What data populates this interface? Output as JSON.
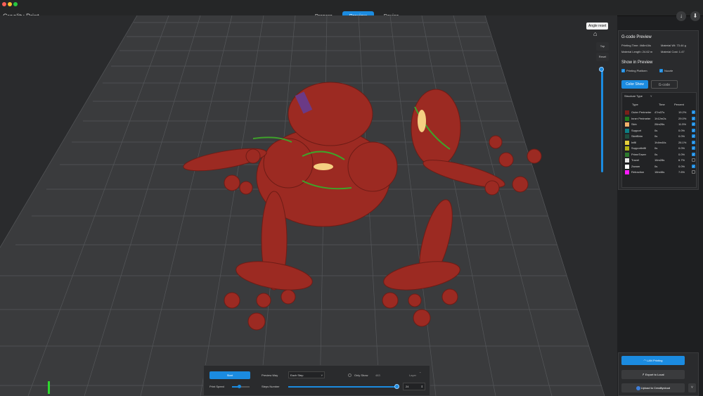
{
  "window": {
    "traffic_lights": [
      "#ff5f57",
      "#febc2e",
      "#28c840"
    ]
  },
  "app": {
    "title": "Creality Print"
  },
  "tabs": [
    {
      "label": "Prepare",
      "active": false
    },
    {
      "label": "Preview",
      "active": true
    },
    {
      "label": "Device",
      "active": false
    }
  ],
  "toolbar": {
    "download_icon": "arrow-down-icon",
    "save_icon": "upload-icon"
  },
  "view_tools": {
    "tooltip": "Angle reset",
    "top_label": "Top",
    "reset_label": "Reset"
  },
  "gcode_preview": {
    "title": "G-code Preview",
    "printing_time": "Printing Time: 4h8m16s",
    "material_wt": "Material Wt: 73.44 g",
    "material_length": "Material Length: 24.62 m",
    "material_cost": "Material Cost: 1.47",
    "show_in_preview": "Show in Preview",
    "printing_platform": "Printing Platform",
    "nozzle": "Nozzle",
    "color_show": "Color Show",
    "gcode": "G-code",
    "structure_type": "Structure Type",
    "col_type": "Type",
    "col_time": "Time",
    "col_percent": "Percent",
    "rows": [
      {
        "name": "Outer Perimeter",
        "time": "47m37s",
        "percent": "19.2%",
        "color": "#7b1f1a",
        "checked": true
      },
      {
        "name": "Inner Perimeter",
        "time": "1h12m2s",
        "percent": "29.0%",
        "color": "#1e7d1e",
        "checked": true
      },
      {
        "name": "Skin",
        "time": "28m26s",
        "percent": "11.5%",
        "color": "#f2b16b",
        "checked": true
      },
      {
        "name": "Support",
        "time": "0s",
        "percent": "0.0%",
        "color": "#0d7f86",
        "checked": true
      },
      {
        "name": "SkirtBrim",
        "time": "0s",
        "percent": "0.0%",
        "color": "#1f4f3f",
        "checked": true
      },
      {
        "name": "Infill",
        "time": "1h4m44s",
        "percent": "26.1%",
        "color": "#e6cf3a",
        "checked": true
      },
      {
        "name": "SupportInfill",
        "time": "0s",
        "percent": "0.0%",
        "color": "#b5b515",
        "checked": true
      },
      {
        "name": "PrimeTower",
        "time": "0s",
        "percent": "0.0%",
        "color": "#2e7a2e",
        "checked": true
      },
      {
        "name": "Travel",
        "time": "16m28s",
        "percent": "6.7%",
        "color": "#e8e8e8",
        "checked": false
      },
      {
        "name": "Zseam",
        "time": "0s",
        "percent": "0.0%",
        "color": "#ffffff",
        "checked": true
      },
      {
        "name": "Retraction",
        "time": "18m46s",
        "percent": "7.6%",
        "color": "#ff1aff",
        "checked": false
      }
    ]
  },
  "playback": {
    "start": "Start",
    "preview_way": "Preview Way",
    "preview_way_value": "Each Step",
    "only_show": "Only Show",
    "only_show_value": "483",
    "layer": "Layer",
    "print_speed": "Print Speed",
    "steps_number": "Steps Number",
    "steps_value": "24"
  },
  "actions": {
    "lan_printing": "LAN Printing",
    "export_local": "Export to Local",
    "upload_cloud": "Upload to Crealitycloud"
  }
}
